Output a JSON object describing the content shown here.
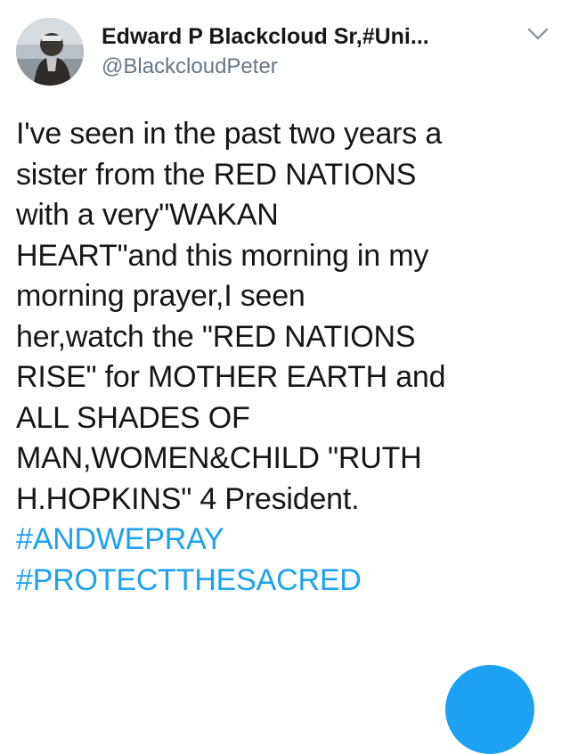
{
  "author": {
    "display_name": "Edward P Blackcloud Sr,#Uni...",
    "handle": "@BlackcloudPeter",
    "avatar_icon": "user-avatar-photo"
  },
  "menu": {
    "icon": "chevron-down-icon"
  },
  "tweet": {
    "lines": [
      "I've seen in the past two years a",
      "sister from the RED NATIONS",
      "with a very\"WAKAN",
      "HEART\"and this morning in my",
      "morning prayer,I seen",
      "her,watch the \"RED NATIONS",
      "RISE\" for MOTHER EARTH and",
      "ALL SHADES OF",
      "MAN,WOMEN&CHILD \"RUTH",
      "H.HOPKINS\" 4 President."
    ],
    "hashtags": [
      "#ANDWEPRAY",
      "#PROTECTTHESACRED"
    ]
  },
  "compose": {
    "icon": "compose-icon"
  },
  "colors": {
    "text": "#14171a",
    "secondary": "#657786",
    "accent": "#1da1f2"
  }
}
